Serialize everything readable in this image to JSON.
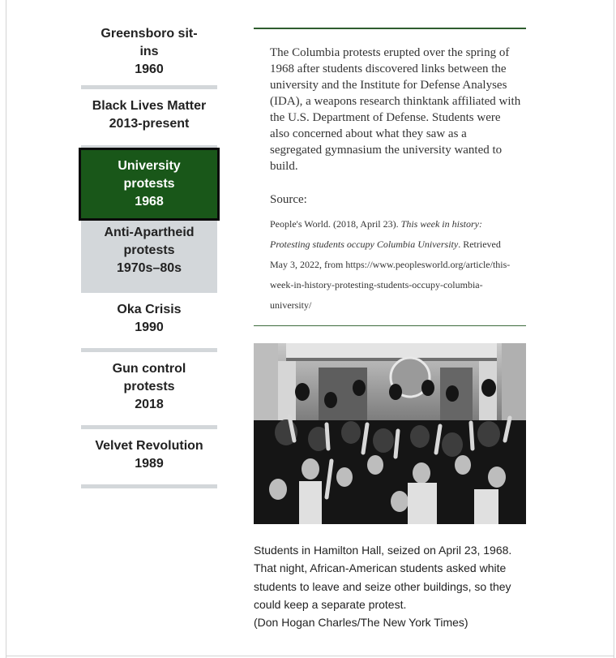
{
  "sidebar": {
    "items": [
      {
        "label": "Greensboro sit-\nins\n1960",
        "style": "plain"
      },
      {
        "label": "Black Lives Matter\n2013-present",
        "style": "plain"
      },
      {
        "label": "University\nprotests\n1968",
        "style": "active"
      },
      {
        "label": "Anti-Apartheid\nprotests\n1970s–80s",
        "style": "gray"
      },
      {
        "label": "Oka Crisis\n1990",
        "style": "plain"
      },
      {
        "label": "Gun control\nprotests\n2018",
        "style": "plain"
      },
      {
        "label": "Velvet Revolution\n1989",
        "style": "plain"
      }
    ]
  },
  "main": {
    "body": "The Columbia protests erupted over the spring of 1968 after students discovered links between the university and the Institute for Defense Analyses (IDA), a weapons research thinktank affiliated with the U.S. Department of Defense. Students were also concerned about what they saw as a segregated gymnasium the university wanted to build.",
    "source_label": "Source:",
    "citation": {
      "lead": "People's World. (2018, April 23). ",
      "title_italic": "This week in history: Protesting students occupy Columbia University",
      "after_title": ". Retrieved May 3, 2022, from https://www.peoplesworld.org/article/this-week-in-history-protesting-students-occupy-columbia-university/"
    },
    "caption_text": "Students in Hamilton Hall, seized on April 23, 1968. That night, African-American students asked white students to leave and seize other buildings, so they could keep a separate protest.",
    "caption_credit": "(Don Hogan Charles/The New York Times)"
  },
  "colors": {
    "active_bg": "#195719",
    "divider": "#d3d7da",
    "rule": "#2e5d2e"
  }
}
